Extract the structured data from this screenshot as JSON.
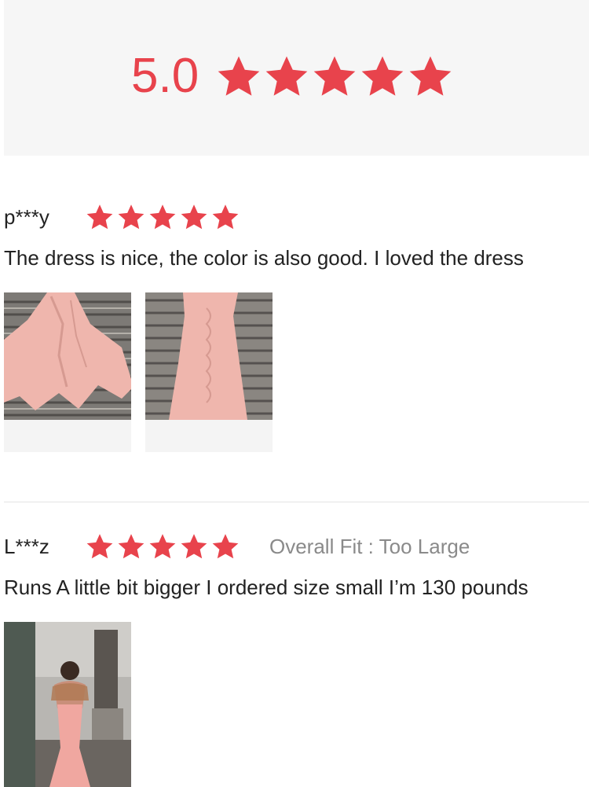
{
  "summary": {
    "score": "5.0",
    "stars": 5,
    "star_color": "#e8434c"
  },
  "reviews": [
    {
      "reviewer": "p***y",
      "stars": 5,
      "text": "The dress is nice, the color is also good. I loved the dress",
      "photos": [
        "pink-ruched-dress-photo",
        "pink-ruched-dress-photo"
      ]
    },
    {
      "reviewer": "L***z",
      "stars": 5,
      "fit": "Overall Fit : Too Large",
      "text": "Runs A little bit bigger I ordered size small I’m 130 pounds",
      "photos": [
        "customer-mirror-selfie-photo"
      ]
    }
  ]
}
